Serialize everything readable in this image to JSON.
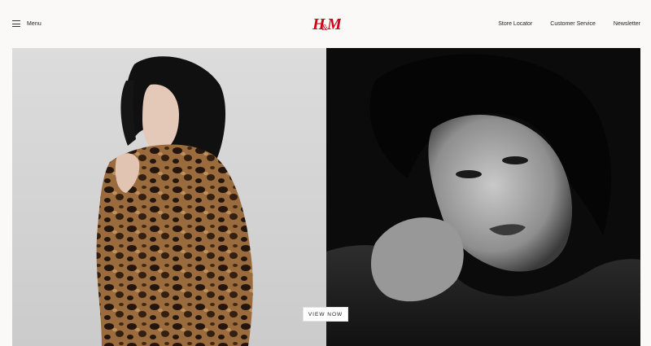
{
  "header": {
    "menu_label": "Menu",
    "logo_text": "H&M",
    "logo_color": "#d0021b",
    "nav": [
      {
        "label": "Store Locator"
      },
      {
        "label": "Customer Service"
      },
      {
        "label": "Newsletter"
      }
    ]
  },
  "hero": {
    "cta_label": "VIEW NOW",
    "left_image": "model-in-leopard-faux-fur-coat",
    "right_image": "black-and-white-portrait-close-up"
  },
  "icons": {
    "menu": "hamburger-icon"
  }
}
